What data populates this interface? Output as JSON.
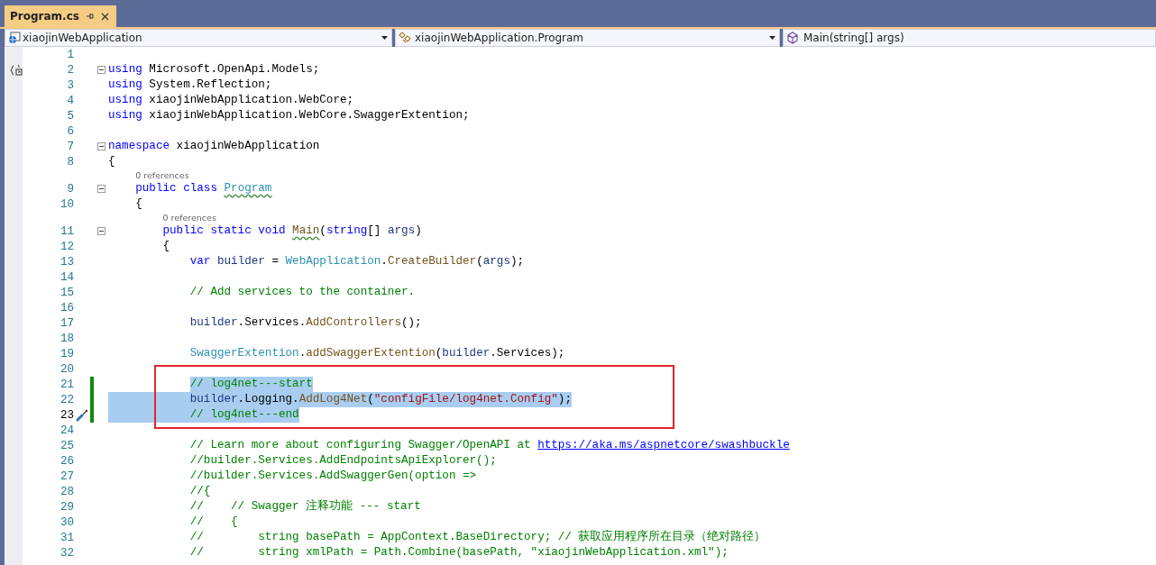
{
  "tab": {
    "title": "Program.cs",
    "selected": true
  },
  "nav": [
    {
      "kind": "project",
      "text": "xiaojinWebApplication"
    },
    {
      "kind": "class",
      "text": "xiaojinWebApplication.Program"
    },
    {
      "kind": "method",
      "text": "Main(string[] args)"
    }
  ],
  "lines": [
    {
      "kind": "code",
      "n": "1",
      "foldable": false,
      "changed": false,
      "current": false
    },
    {
      "kind": "code",
      "n": "2",
      "scope_icon": true,
      "foldable": true,
      "changed": false,
      "current": false,
      "selected": false,
      "tokens": [
        {
          "kind": "kw",
          "text": "using"
        },
        {
          "kind": "p",
          "text": " Microsoft.OpenApi.Models;"
        }
      ]
    },
    {
      "kind": "code",
      "n": "3",
      "foldable": false,
      "changed": false,
      "current": false,
      "selected": false,
      "tokens": [
        {
          "kind": "kw",
          "text": "using"
        },
        {
          "kind": "p",
          "text": " System.Reflection;"
        }
      ]
    },
    {
      "kind": "code",
      "n": "4",
      "foldable": false,
      "changed": false,
      "current": false,
      "selected": false,
      "tokens": [
        {
          "kind": "kw",
          "text": "using"
        },
        {
          "kind": "p",
          "text": " xiaojinWebApplication.WebCore;"
        }
      ]
    },
    {
      "kind": "code",
      "n": "5",
      "foldable": false,
      "changed": false,
      "current": false,
      "selected": false,
      "tokens": [
        {
          "kind": "kw",
          "text": "using"
        },
        {
          "kind": "p",
          "text": " xiaojinWebApplication.WebCore.SwaggerExtention;"
        }
      ]
    },
    {
      "kind": "code",
      "n": "6",
      "foldable": false,
      "changed": false,
      "current": false
    },
    {
      "kind": "code",
      "n": "7",
      "foldable": true,
      "changed": false,
      "current": false,
      "selected": false,
      "tokens": [
        {
          "kind": "kw",
          "text": "namespace"
        },
        {
          "kind": "p",
          "text": " xiaojinWebApplication"
        }
      ]
    },
    {
      "kind": "code",
      "n": "8",
      "foldable": false,
      "changed": false,
      "current": false,
      "selected": false,
      "tokens": [
        {
          "kind": "p",
          "text": "{"
        }
      ]
    },
    {
      "kind": "lens",
      "text": "0 references"
    },
    {
      "kind": "code",
      "n": "9",
      "foldable": true,
      "changed": false,
      "current": false,
      "selected": false,
      "tokens": [
        {
          "kind": "kw",
          "text": "    public"
        },
        {
          "kind": "kw",
          "text": " class"
        },
        {
          "kind": "type-sq",
          "text": " Program"
        }
      ]
    },
    {
      "kind": "code",
      "n": "10",
      "foldable": false,
      "changed": false,
      "current": false,
      "selected": false,
      "tokens": [
        {
          "kind": "p",
          "text": "    {"
        }
      ]
    },
    {
      "kind": "lens",
      "text": "0 references"
    },
    {
      "kind": "code",
      "n": "11",
      "foldable": true,
      "changed": false,
      "current": false,
      "selected": false,
      "tokens": [
        {
          "kind": "kw",
          "text": "        public"
        },
        {
          "kind": "kw",
          "text": " static"
        },
        {
          "kind": "kw",
          "text": " void"
        },
        {
          "kind": "method-sq",
          "text": " Main"
        },
        {
          "kind": "p",
          "text": "("
        },
        {
          "kind": "kw",
          "text": "string"
        },
        {
          "kind": "p",
          "text": "[]"
        },
        {
          "kind": "local",
          "text": " args"
        },
        {
          "kind": "p",
          "text": ")"
        }
      ]
    },
    {
      "kind": "code",
      "n": "12",
      "foldable": false,
      "changed": false,
      "current": false,
      "selected": false,
      "tokens": [
        {
          "kind": "p",
          "text": "        {"
        }
      ]
    },
    {
      "kind": "code",
      "n": "13",
      "foldable": false,
      "changed": false,
      "current": false,
      "selected": false,
      "tokens": [
        {
          "kind": "kw",
          "text": "            var"
        },
        {
          "kind": "local",
          "text": " builder"
        },
        {
          "kind": "p",
          "text": " ="
        },
        {
          "kind": "type",
          "text": " WebApplication"
        },
        {
          "kind": "p",
          "text": "."
        },
        {
          "kind": "method",
          "text": "CreateBuilder"
        },
        {
          "kind": "p",
          "text": "("
        },
        {
          "kind": "local",
          "text": "args"
        },
        {
          "kind": "p",
          "text": ");"
        }
      ]
    },
    {
      "kind": "code",
      "n": "14",
      "foldable": false,
      "changed": false,
      "current": false
    },
    {
      "kind": "code",
      "n": "15",
      "foldable": false,
      "changed": false,
      "current": false,
      "selected": false,
      "tokens": [
        {
          "kind": "comment",
          "text": "            // Add services to the container."
        }
      ]
    },
    {
      "kind": "code",
      "n": "16",
      "foldable": false,
      "changed": false,
      "current": false
    },
    {
      "kind": "code",
      "n": "17",
      "foldable": false,
      "changed": false,
      "current": false,
      "selected": false,
      "tokens": [
        {
          "kind": "local",
          "text": "            builder"
        },
        {
          "kind": "p",
          "text": ".Services."
        },
        {
          "kind": "method",
          "text": "AddControllers"
        },
        {
          "kind": "p",
          "text": "();"
        }
      ]
    },
    {
      "kind": "code",
      "n": "18",
      "foldable": false,
      "changed": false,
      "current": false
    },
    {
      "kind": "code",
      "n": "19",
      "foldable": false,
      "changed": false,
      "current": false,
      "selected": false,
      "tokens": [
        {
          "kind": "type",
          "text": "            SwaggerExtention"
        },
        {
          "kind": "p",
          "text": "."
        },
        {
          "kind": "method",
          "text": "addSwaggerExtention"
        },
        {
          "kind": "p",
          "text": "("
        },
        {
          "kind": "local",
          "text": "builder"
        },
        {
          "kind": "p",
          "text": ".Services);"
        }
      ]
    },
    {
      "kind": "code",
      "n": "20",
      "foldable": false,
      "changed": false,
      "current": false
    },
    {
      "kind": "code",
      "n": "21",
      "foldable": false,
      "changed": true,
      "current": false,
      "selected": true,
      "tokens": [
        {
          "kind": "comment",
          "text": "            // log4net---start"
        }
      ]
    },
    {
      "kind": "code",
      "n": "22",
      "foldable": false,
      "changed": true,
      "current": false,
      "selected": true,
      "tokens": [
        {
          "kind": "local",
          "text": "            builder"
        },
        {
          "kind": "p",
          "text": ".Logging."
        },
        {
          "kind": "method",
          "text": "AddLog4Net"
        },
        {
          "kind": "p",
          "text": "("
        },
        {
          "kind": "string",
          "text": "\"configFile/log4net.Config\""
        },
        {
          "kind": "p",
          "text": ");"
        }
      ]
    },
    {
      "kind": "code",
      "n": "23",
      "foldable": false,
      "changed": true,
      "current": true,
      "quick_action": true,
      "selected": true,
      "tokens": [
        {
          "kind": "comment",
          "text": "            // log4net---end"
        }
      ]
    },
    {
      "kind": "code",
      "n": "24",
      "foldable": false,
      "changed": false,
      "current": false
    },
    {
      "kind": "code",
      "n": "25",
      "foldable": false,
      "changed": false,
      "current": false,
      "selected": false,
      "tokens": [
        {
          "kind": "comment",
          "text": "            // Learn more about configuring Swagger/OpenAPI at"
        },
        {
          "kind": "link",
          "text": "https://aka.ms/aspnetcore/swashbuckle"
        }
      ]
    },
    {
      "kind": "code",
      "n": "26",
      "foldable": false,
      "changed": false,
      "current": false,
      "selected": false,
      "tokens": [
        {
          "kind": "comment",
          "text": "            //builder.Services.AddEndpointsApiExplorer();"
        }
      ]
    },
    {
      "kind": "code",
      "n": "27",
      "foldable": false,
      "changed": false,
      "current": false,
      "selected": false,
      "tokens": [
        {
          "kind": "comment",
          "text": "            //builder.Services.AddSwaggerGen(option =>"
        }
      ]
    },
    {
      "kind": "code",
      "n": "28",
      "foldable": false,
      "changed": false,
      "current": false,
      "selected": false,
      "tokens": [
        {
          "kind": "comment",
          "text": "            //{"
        }
      ]
    },
    {
      "kind": "code",
      "n": "29",
      "foldable": false,
      "changed": false,
      "current": false,
      "selected": false,
      "tokens": [
        {
          "kind": "comment",
          "text": "            //    // Swagger 注释功能 --- start"
        }
      ]
    },
    {
      "kind": "code",
      "n": "30",
      "foldable": false,
      "changed": false,
      "current": false,
      "selected": false,
      "tokens": [
        {
          "kind": "comment",
          "text": "            //    {"
        }
      ]
    },
    {
      "kind": "code",
      "n": "31",
      "foldable": false,
      "changed": false,
      "current": false,
      "selected": false,
      "tokens": [
        {
          "kind": "comment",
          "text": "            //        string basePath = AppContext.BaseDirectory; // 获取应用程序所在目录（绝对路径）"
        }
      ]
    },
    {
      "kind": "code",
      "n": "32",
      "foldable": false,
      "changed": false,
      "current": false,
      "selected": false,
      "tokens": [
        {
          "kind": "comment",
          "text": "            //        string xmlPath = Path.Combine(basePath, \"xiaojinWebApplication.xml\");"
        }
      ]
    }
  ]
}
